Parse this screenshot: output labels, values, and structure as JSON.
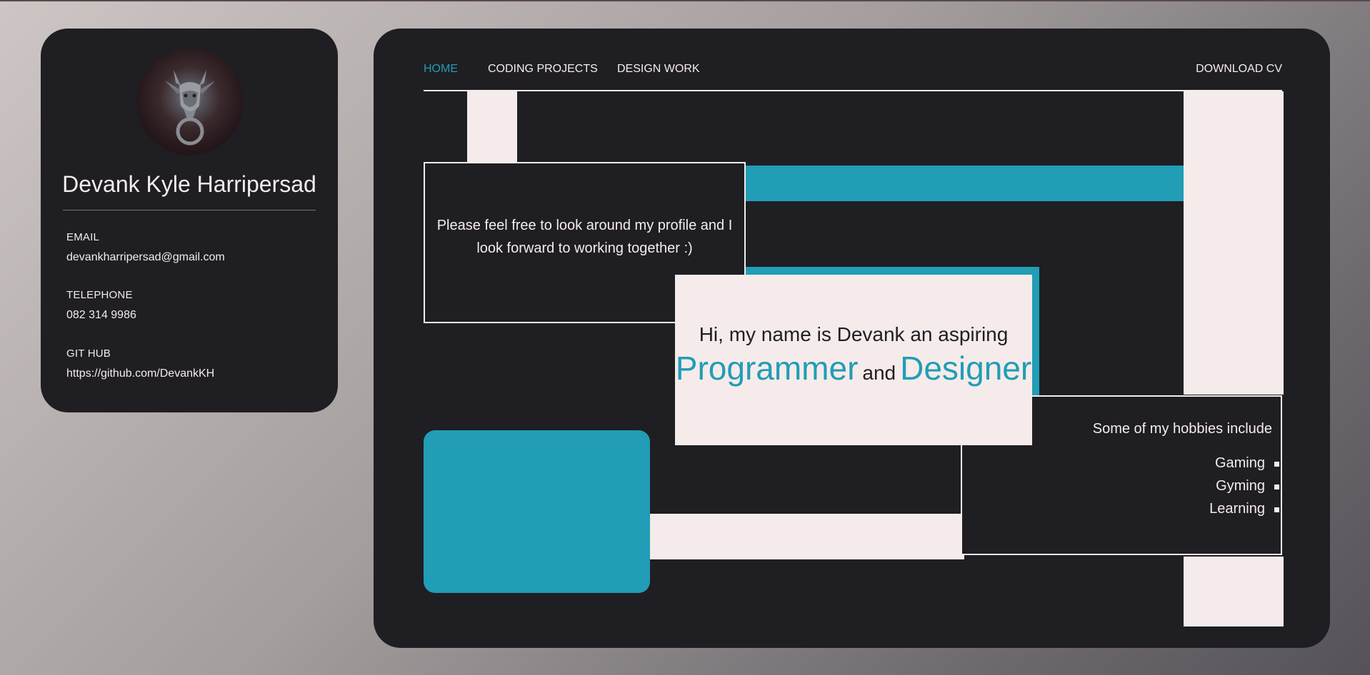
{
  "profile": {
    "name": "Devank Kyle Harripersad",
    "avatar_icon": "dragon-door-knocker-icon",
    "contacts": [
      {
        "label": "EMAIL",
        "value": "devankharripersad@gmail.com"
      },
      {
        "label": "TELEPHONE",
        "value": "082 314 9986"
      },
      {
        "label": "GIT HUB",
        "value": "https://github.com/DevankKH"
      }
    ]
  },
  "nav": {
    "items": [
      "HOME",
      "CODING PROJECTS",
      "DESIGN WORK"
    ],
    "active": "HOME",
    "download_label": "DOWNLOAD CV"
  },
  "intro": {
    "message": "Please feel free to look around my profile and I look forward to working together :)",
    "hero_line1": "Hi, my name is Devank an aspiring",
    "role1": "Programmer",
    "conjunction": "and",
    "role2": "Designer"
  },
  "hobbies": {
    "title": "Some of my hobbies include",
    "items": [
      "Gaming",
      "Gyming",
      "Learning"
    ]
  },
  "colors": {
    "accent": "#219db5",
    "panel": "#1f1e23",
    "light": "#f5ebea"
  }
}
